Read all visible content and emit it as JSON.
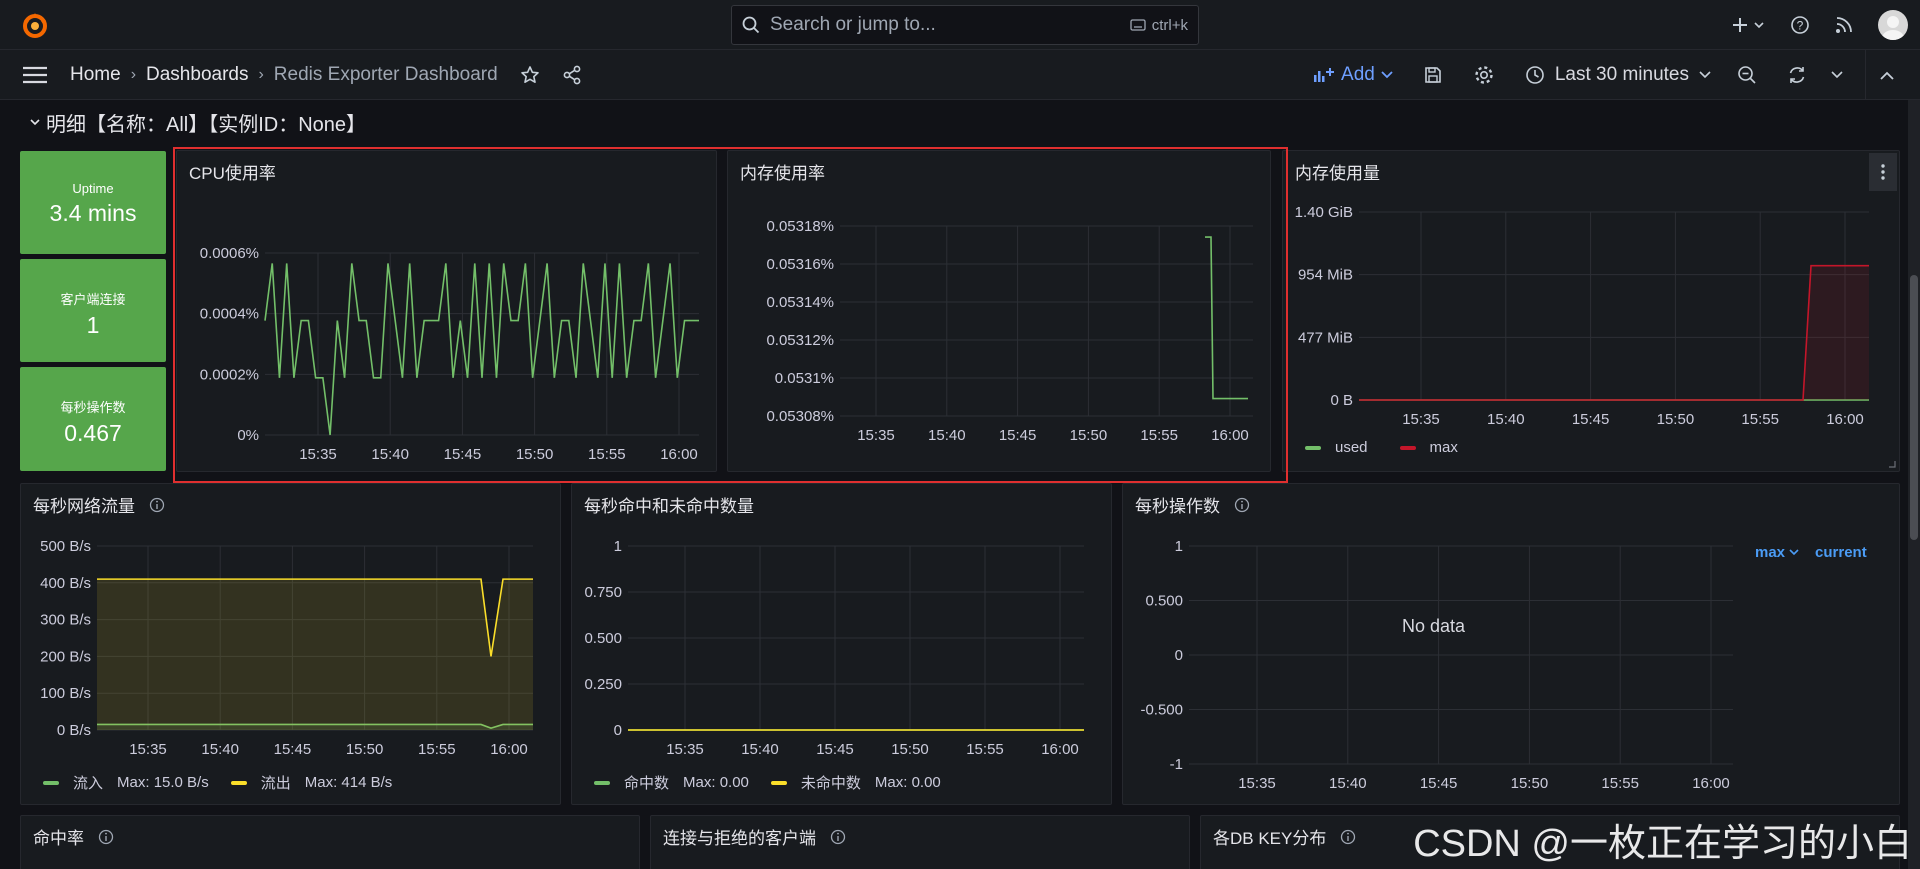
{
  "topbar": {
    "search_placeholder": "Search or jump to...",
    "search_shortcut": "ctrl+k"
  },
  "breadcrumb": {
    "home": "Home",
    "dashboards": "Dashboards",
    "current": "Redis Exporter Dashboard"
  },
  "toolbar": {
    "add_label": "Add",
    "time_range": "Last 30 minutes"
  },
  "row": {
    "title": "明细【名称：All】【实例ID：None】"
  },
  "stats": [
    {
      "label": "Uptime",
      "value": "3.4 mins"
    },
    {
      "label": "客户端连接",
      "value": "1"
    },
    {
      "label": "每秒操作数",
      "value": "0.467"
    }
  ],
  "time_ticks": [
    "15:35",
    "15:40",
    "15:45",
    "15:50",
    "15:55",
    "16:00"
  ],
  "panels": {
    "cpu": {
      "title": "CPU使用率"
    },
    "mem_rate": {
      "title": "内存使用率"
    },
    "mem_used": {
      "title": "内存使用量"
    },
    "net": {
      "title": "每秒网络流量"
    },
    "hits": {
      "title": "每秒命中和未命中数量"
    },
    "ops": {
      "title": "每秒操作数",
      "no_data": "No data",
      "legend_max": "max",
      "legend_current": "current"
    },
    "hit_rate": {
      "title": "命中率"
    },
    "conn": {
      "title": "连接与拒绝的客户端"
    },
    "dbkey": {
      "title": "各DB KEY分布"
    }
  },
  "chart_data": [
    {
      "type": "line",
      "title": "CPU使用率",
      "y_ticks": [
        "0%",
        "0.0002%",
        "0.0004%",
        "0.0006%"
      ],
      "ylim": [
        0,
        0.0007
      ],
      "x_ticks": [
        "15:35",
        "15:40",
        "15:45",
        "15:50",
        "15:55",
        "16:00"
      ],
      "series": [
        {
          "color": "#73bf69",
          "values": [
            0.00044,
            0.00066,
            0.00022,
            0.00066,
            0.00022,
            0.00044,
            0.00044,
            0.00022,
            0.00022,
            0,
            0.00044,
            0.00022,
            0.00066,
            0.00044,
            0.00044,
            0.00022,
            0.00022,
            0.00066,
            0.00044,
            0.00022,
            0.00066,
            0.00022,
            0.00044,
            0.00044,
            0.00044,
            0.00066,
            0.00022,
            0.00044,
            0.00022,
            0.00066,
            0.00022,
            0.00066,
            0.00022,
            0.00066,
            0.00044,
            0.00044,
            0.00066,
            0.00022,
            0.00044,
            0.00066,
            0.00022,
            0.00044,
            0.00044,
            0.00022,
            0.00066,
            0.00044,
            0.00022,
            0.00066,
            0.00022,
            0.00066,
            0.00022,
            0.00044,
            0.00044,
            0.00066,
            0.00022,
            0.00044,
            0.00066,
            0.00022,
            0.00044,
            0.00044,
            0.00044
          ]
        }
      ]
    },
    {
      "type": "line",
      "title": "内存使用率",
      "y_ticks": [
        "0.05308%",
        "0.0531%",
        "0.05312%",
        "0.05314%",
        "0.05316%",
        "0.05318%"
      ],
      "ylim": [
        0.05307,
        0.05319
      ],
      "x_ticks": [
        "15:35",
        "15:40",
        "15:45",
        "15:50",
        "15:55",
        "16:00"
      ],
      "series": [
        {
          "color": "#73bf69",
          "values": [
            0.053183,
            0.053183,
            0.053081,
            0.053081
          ]
        }
      ]
    },
    {
      "type": "area",
      "title": "内存使用量",
      "y_ticks": [
        "0 B",
        "477 MiB",
        "954 MiB",
        "1.40 GiB"
      ],
      "ylim": [
        0,
        1.4
      ],
      "x_ticks": [
        "15:35",
        "15:40",
        "15:45",
        "15:50",
        "15:55",
        "16:00"
      ],
      "series": [
        {
          "name": "used",
          "color": "#73bf69",
          "values": [
            0,
            0,
            0
          ]
        },
        {
          "name": "max",
          "color": "#c4162a",
          "values": [
            0,
            0,
            1.0,
            1.0
          ]
        }
      ]
    },
    {
      "type": "area",
      "title": "每秒网络流量",
      "y_ticks": [
        "0 B/s",
        "100 B/s",
        "200 B/s",
        "300 B/s",
        "400 B/s",
        "500 B/s"
      ],
      "ylim": [
        0,
        500
      ],
      "x_ticks": [
        "15:35",
        "15:40",
        "15:45",
        "15:50",
        "15:55",
        "16:00"
      ],
      "series": [
        {
          "name": "流入",
          "color": "#73bf69",
          "values": [
            15,
            15,
            15,
            15,
            5,
            15,
            15
          ],
          "legend_stat": "Max: 15.0 B/s"
        },
        {
          "name": "流出",
          "color": "#fade2a",
          "values": [
            410,
            410,
            410,
            410,
            200,
            410,
            410
          ],
          "legend_stat": "Max: 414 B/s"
        }
      ]
    },
    {
      "type": "line",
      "title": "每秒命中和未命中数量",
      "y_ticks": [
        "0",
        "0.250",
        "0.500",
        "0.750",
        "1"
      ],
      "ylim": [
        0,
        1
      ],
      "x_ticks": [
        "15:35",
        "15:40",
        "15:45",
        "15:50",
        "15:55",
        "16:00"
      ],
      "series": [
        {
          "name": "命中数",
          "color": "#73bf69",
          "values": [
            0,
            0
          ],
          "legend_stat": "Max: 0.00"
        },
        {
          "name": "未命中数",
          "color": "#fade2a",
          "values": [
            0,
            0
          ],
          "legend_stat": "Max: 0.00"
        }
      ]
    },
    {
      "type": "line",
      "title": "每秒操作数",
      "y_ticks": [
        "-1",
        "-0.500",
        "0",
        "0.500",
        "1"
      ],
      "ylim": [
        -1,
        1
      ],
      "x_ticks": [
        "15:35",
        "15:40",
        "15:45",
        "15:50",
        "15:55",
        "16:00"
      ],
      "series": []
    }
  ],
  "watermark": "CSDN @一枚正在学习的小白"
}
